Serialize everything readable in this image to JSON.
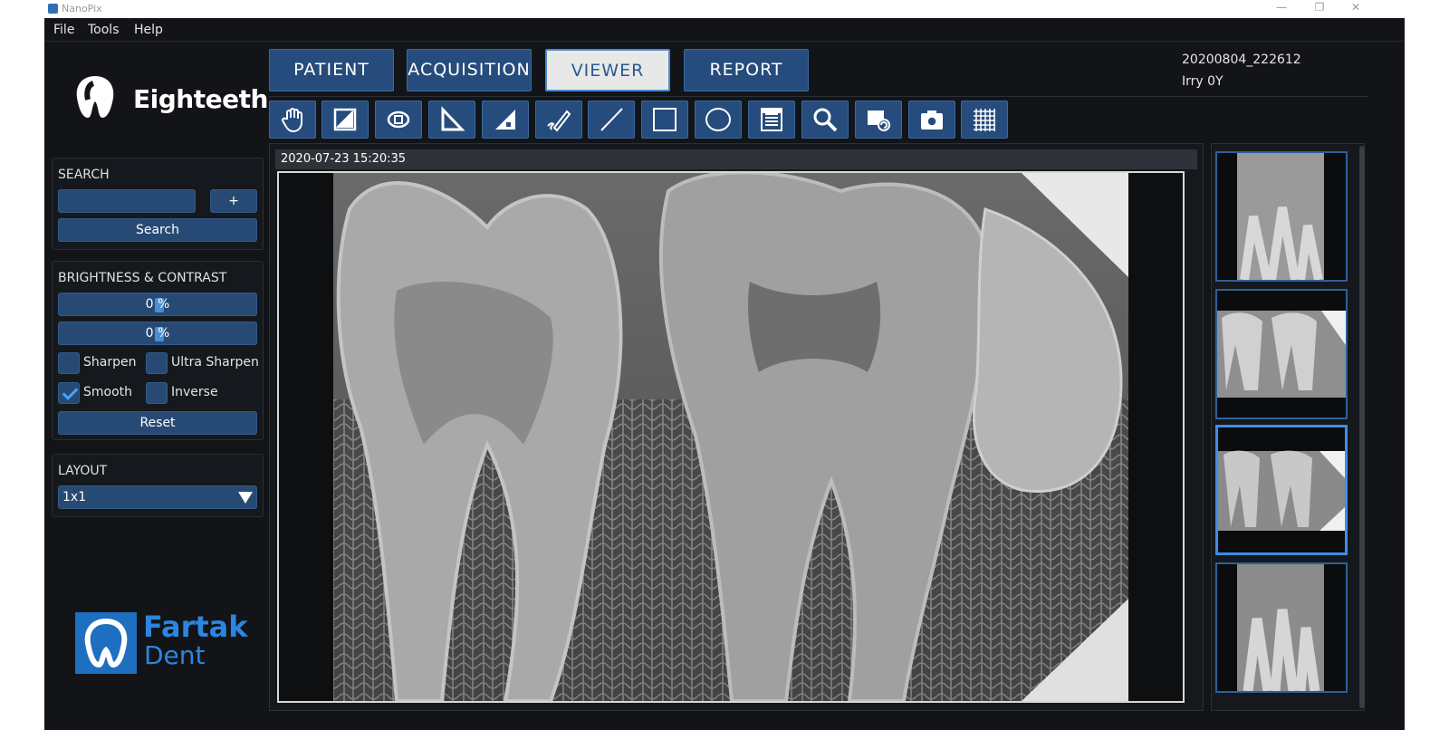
{
  "window": {
    "title": "NanoPix",
    "controls": [
      "—",
      "❐",
      "✕"
    ]
  },
  "menu": [
    "File",
    "Tools",
    "Help"
  ],
  "brand": {
    "name": "Eighteeth"
  },
  "watermark": {
    "line1": "Fartak",
    "line2": "Dent"
  },
  "search": {
    "title": "SEARCH",
    "input_value": "",
    "add_label": "+",
    "button_label": "Search"
  },
  "brightness_contrast": {
    "title": "BRIGHTNESS & CONTRAST",
    "brightness": "0 %",
    "contrast": "0 %",
    "sharpen": {
      "label": "Sharpen",
      "checked": false
    },
    "ultra_sharpen": {
      "label": "Ultra Sharpen",
      "checked": false
    },
    "smooth": {
      "label": "Smooth",
      "checked": true
    },
    "inverse": {
      "label": "Inverse",
      "checked": false
    },
    "reset_label": "Reset"
  },
  "layout": {
    "title": "LAYOUT",
    "selected": "1x1"
  },
  "tabs": [
    {
      "label": "PATIENT",
      "active": false
    },
    {
      "label": "ACQUISITION",
      "active": false
    },
    {
      "label": "VIEWER",
      "active": true
    },
    {
      "label": "REPORT",
      "active": false
    }
  ],
  "patient": {
    "id": "20200804_222612",
    "name_age": "Irry 0Y"
  },
  "tools": [
    "pan-icon",
    "window-level-icon",
    "rotate-icon",
    "angle-icon",
    "measure-area-icon",
    "pen-icon",
    "line-icon",
    "rectangle-icon",
    "ellipse-icon",
    "text-note-icon",
    "zoom-icon",
    "copy-rotate-icon",
    "camera-icon",
    "grid-icon"
  ],
  "viewer": {
    "timestamp": "2020-07-23 15:20:35"
  },
  "thumbnails": {
    "count": 4,
    "selected_index": 2
  },
  "colors": {
    "accent": "#254c7c",
    "selected_border": "#3d8ee6",
    "background": "#121418"
  }
}
